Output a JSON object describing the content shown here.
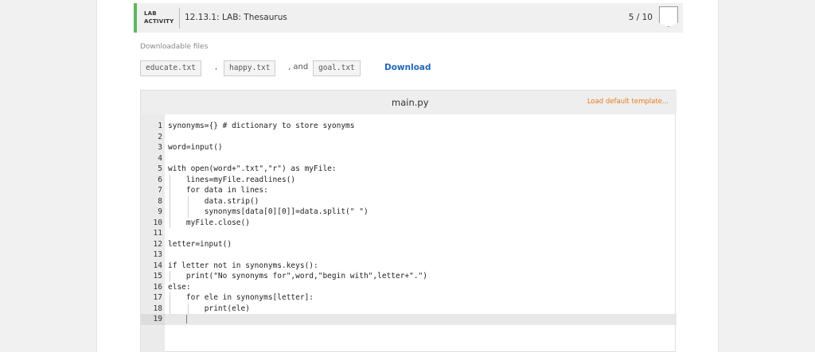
{
  "lab": {
    "tag_line1": "LAB",
    "tag_line2": "ACTIVITY",
    "title": "12.13.1: LAB: Thesaurus",
    "score": "5 / 10"
  },
  "downloads": {
    "label": "Downloadable files",
    "files": [
      "educate.txt",
      "happy.txt",
      "goal.txt"
    ],
    "separator_comma": ",",
    "separator_and": ", and",
    "download_label": "Download"
  },
  "editor": {
    "filename": "main.py",
    "load_default": "Load default template...",
    "lines": [
      "synonyms={} # dictionary to store syonyms",
      "",
      "word=input()",
      "",
      "with open(word+\".txt\",\"r\") as myFile:",
      "    lines=myFile.readlines()",
      "    for data in lines:",
      "        data.strip()",
      "        synonyms[data[0][0]]=data.split(\" \")",
      "    myFile.close()",
      "",
      "letter=input()",
      "",
      "if letter not in synonyms.keys():",
      "    print(\"No synonyms for\",word,\"begin with\",letter+\".\")",
      "else:",
      "    for ele in synonyms[letter]:",
      "        print(ele)",
      ""
    ]
  }
}
